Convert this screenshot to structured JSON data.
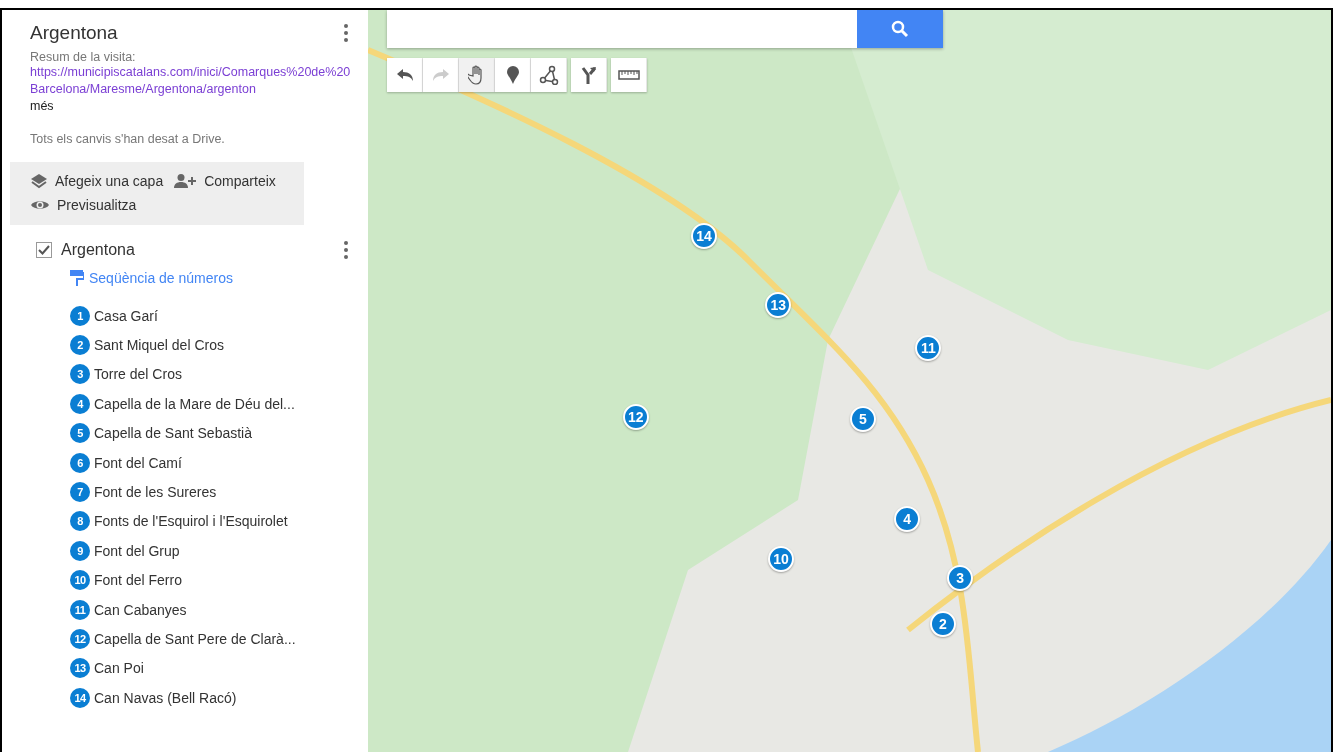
{
  "map_panel": {
    "title": "Argentona",
    "description_label": "Resum de la visita:",
    "description_link": "https://municipiscatalans.com/inici/Comarques%20de%20Barcelona/Maresme/Argentona/argenton",
    "more_link": "més",
    "save_status": "Tots els canvis s'han desat a Drive."
  },
  "actions": [
    {
      "kind": "layers",
      "label": "Afegeix una capa"
    },
    {
      "kind": "share",
      "label": "Comparteix"
    },
    {
      "kind": "preview",
      "label": "Previsualitza"
    }
  ],
  "layer": {
    "name": "Argentona",
    "checked": true,
    "style_link": "Seqüència de números",
    "items": [
      {
        "number": "1",
        "name": "Casa Garí"
      },
      {
        "number": "2",
        "name": "Sant Miquel del Cros"
      },
      {
        "number": "3",
        "name": "Torre del Cros"
      },
      {
        "number": "4",
        "name": "Capella de la Mare de Déu del..."
      },
      {
        "number": "5",
        "name": "Capella de Sant Sebastià"
      },
      {
        "number": "6",
        "name": "Font del Camí"
      },
      {
        "number": "7",
        "name": "Font de les Sureres"
      },
      {
        "number": "8",
        "name": "Fonts de l'Esquirol i l'Esquirolet"
      },
      {
        "number": "9",
        "name": "Font del Grup"
      },
      {
        "number": "10",
        "name": "Font del Ferro"
      },
      {
        "number": "11",
        "name": "Can Cabanyes"
      },
      {
        "number": "12",
        "name": "Capella de Sant Pere de Clarà..."
      },
      {
        "number": "13",
        "name": "Can Poi"
      },
      {
        "number": "14",
        "name": "Can Navas (Bell Racó)"
      }
    ]
  },
  "toolbar": [
    {
      "kind": "undo",
      "selected": false,
      "disabled": false
    },
    {
      "kind": "redo",
      "selected": false,
      "disabled": true
    },
    {
      "kind": "hand",
      "selected": true
    },
    {
      "kind": "marker",
      "selected": false
    },
    {
      "kind": "line",
      "selected": false
    },
    {
      "kind": "directions",
      "selected": false
    },
    {
      "kind": "ruler",
      "selected": false
    }
  ],
  "map_markers": [
    {
      "number": "14"
    },
    {
      "number": "13"
    },
    {
      "number": "11"
    },
    {
      "number": "12"
    },
    {
      "number": "5"
    },
    {
      "number": "4"
    },
    {
      "number": "3"
    },
    {
      "number": "2"
    },
    {
      "number": "10"
    }
  ]
}
